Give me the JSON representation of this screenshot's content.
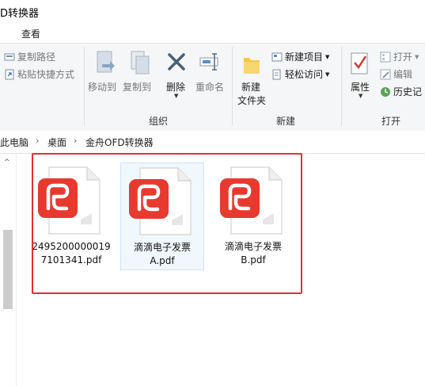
{
  "window": {
    "title": "D转换器"
  },
  "tabs": {
    "view": "查看"
  },
  "ribbon": {
    "clipboard": {
      "copy_path": "复制路径",
      "paste_shortcut": "粘贴快捷方式"
    },
    "organize": {
      "label": "组织",
      "move_to": "移动到",
      "copy_to": "复制到",
      "delete": "删除",
      "rename": "重命名"
    },
    "new": {
      "label": "新建",
      "new_folder_line1": "新建",
      "new_folder_line2": "文件夹",
      "new_item": "新建项目",
      "easy_access": "轻松访问"
    },
    "open": {
      "label": "打开",
      "properties": "属性",
      "open": "打开",
      "edit": "编辑",
      "history": "历史记"
    }
  },
  "address": {
    "crumbs": [
      "此电脑",
      "桌面",
      "金舟OFD转换器"
    ]
  },
  "files": [
    {
      "name": "24952000000197101341.pdf",
      "line1": "2495200000019",
      "line2": "7101341.pdf"
    },
    {
      "name": "滴滴电子发票A.pdf",
      "line1": "滴滴电子发票",
      "line2": "A.pdf"
    },
    {
      "name": "滴滴电子发票B.pdf",
      "line1": "滴滴电子发票",
      "line2": "B.pdf"
    }
  ],
  "colors": {
    "pdf_red": "#e8392f",
    "highlight_border": "#e03030",
    "selection": "#cfe3f7"
  },
  "icons": {
    "pdf": "pdf-file-icon",
    "copy_path": "copy-path-icon",
    "paste_shortcut": "paste-shortcut-icon",
    "move_to": "move-to-icon",
    "copy_to": "copy-to-icon",
    "delete": "delete-icon",
    "rename": "rename-icon",
    "new_folder": "new-folder-icon",
    "new_item": "new-item-icon",
    "easy_access": "easy-access-icon",
    "properties": "properties-icon",
    "open": "open-icon",
    "edit": "edit-icon",
    "history": "history-icon"
  }
}
